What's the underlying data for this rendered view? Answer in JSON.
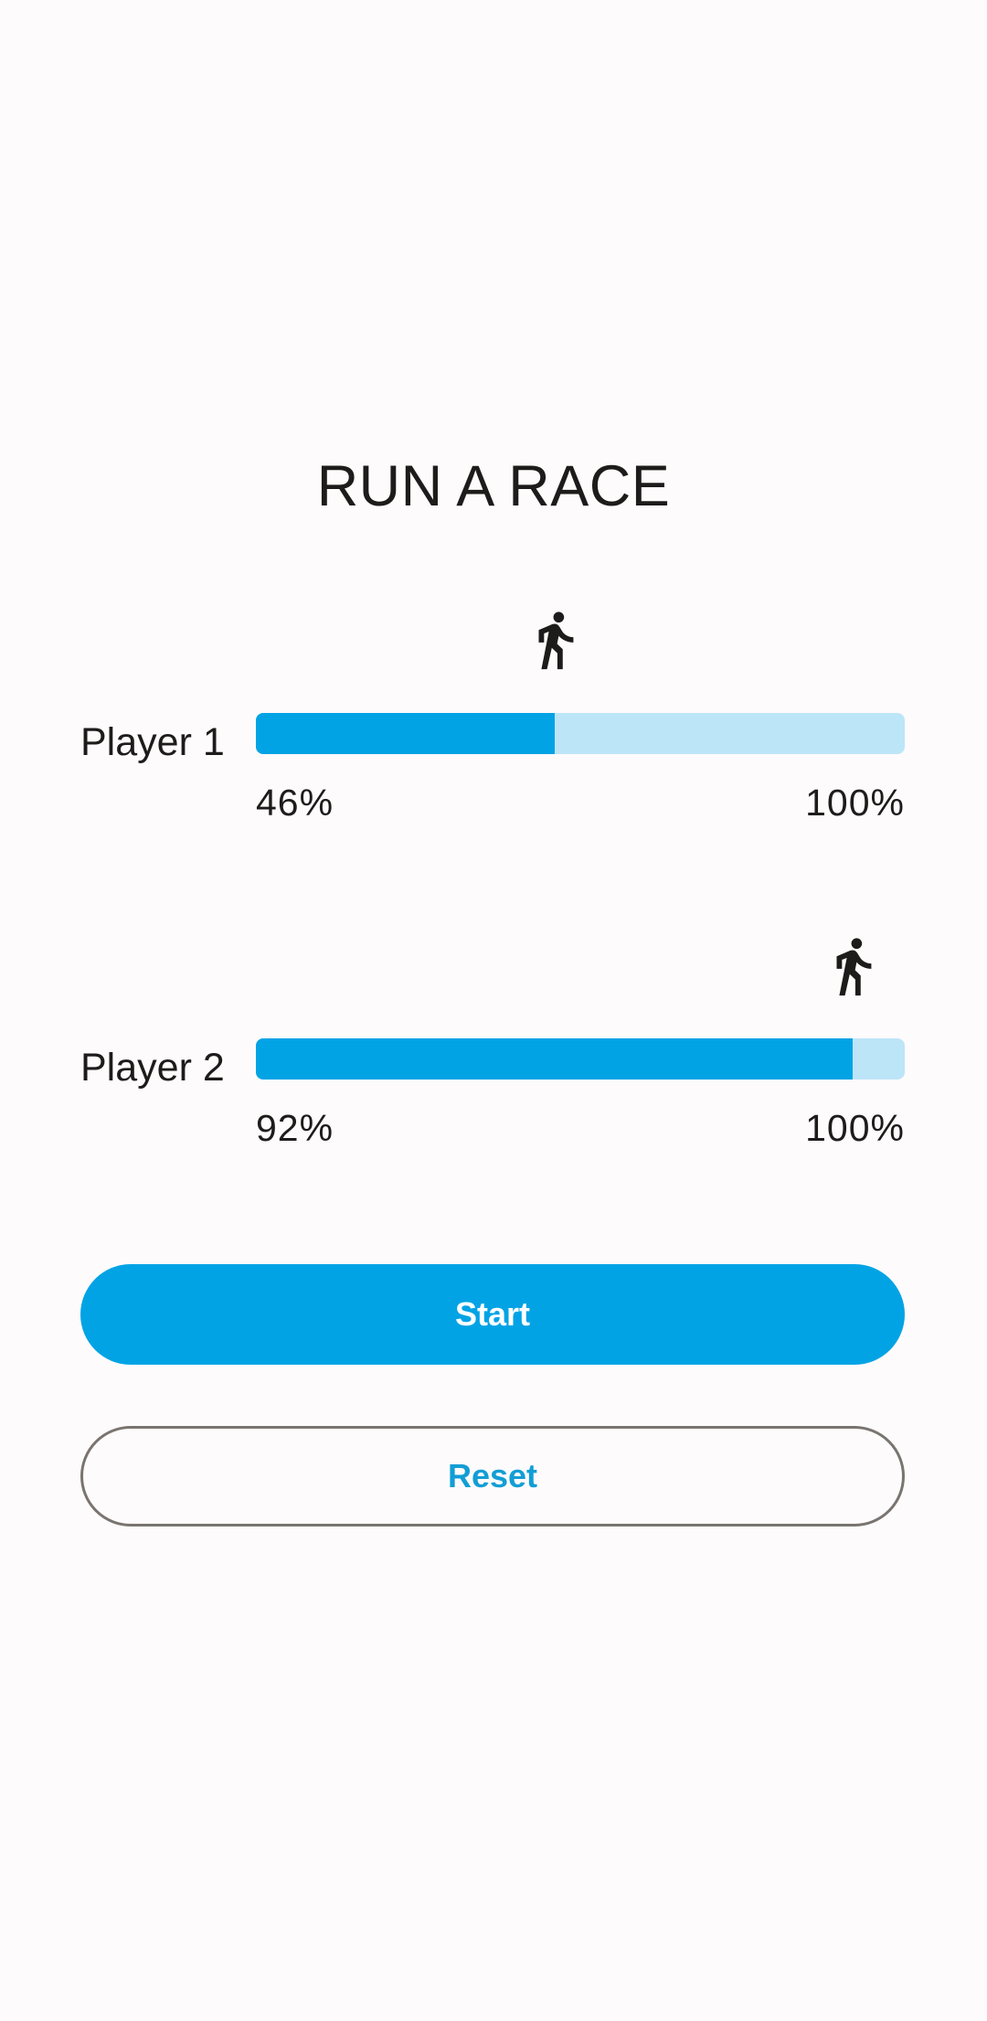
{
  "app": {
    "title": "RUN A RACE"
  },
  "players": [
    {
      "label": "Player 1",
      "progress_percent": 46,
      "progress_text": "46%",
      "max_text": "100%",
      "icon": "walking-person-icon"
    },
    {
      "label": "Player 2",
      "progress_percent": 92,
      "progress_text": "92%",
      "max_text": "100%",
      "icon": "walking-person-icon"
    }
  ],
  "buttons": {
    "start_label": "Start",
    "reset_label": "Reset"
  },
  "colors": {
    "accent": "#02A3E5",
    "track": "#BDE5F8",
    "background": "#FEFBFC",
    "text": "#1E1B1B",
    "reset_text": "#129ED5",
    "reset_border": "#7A7470"
  }
}
